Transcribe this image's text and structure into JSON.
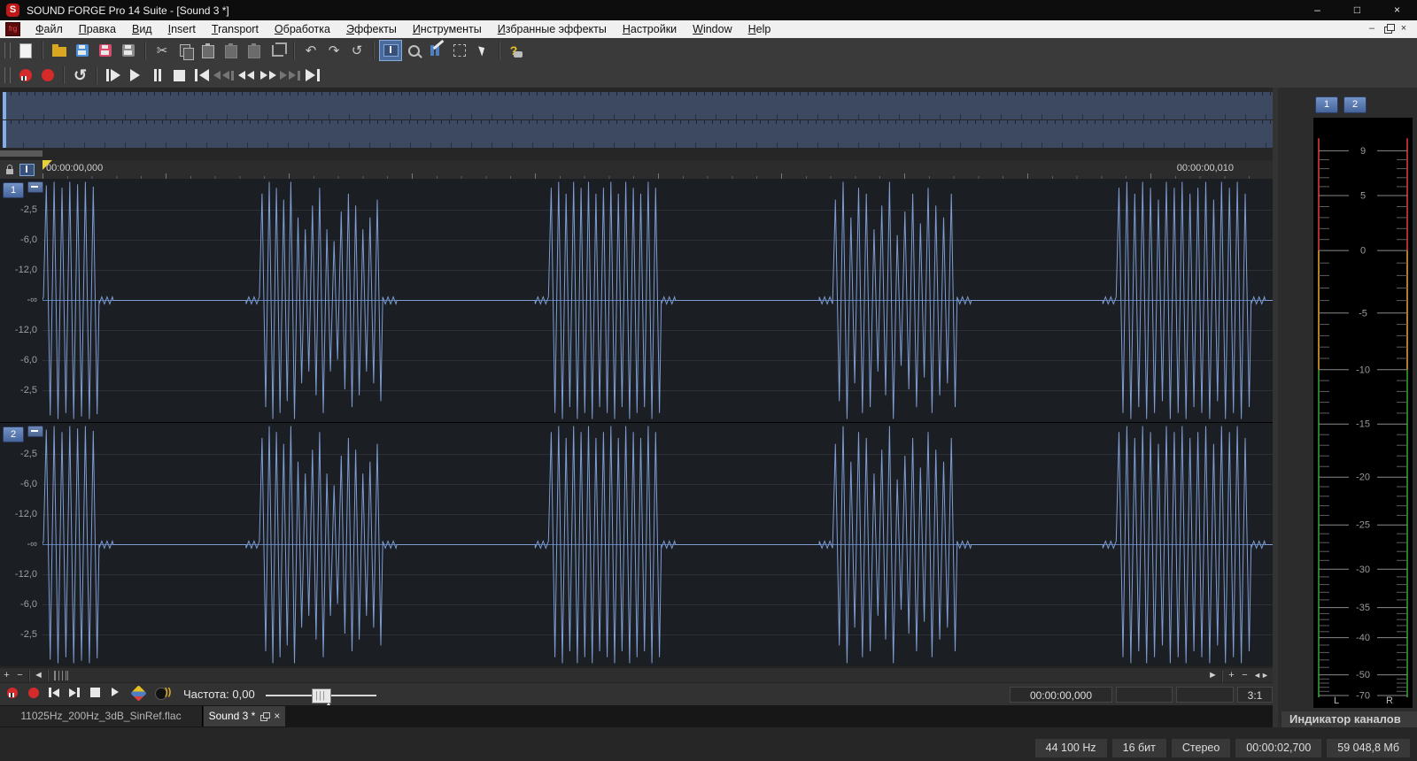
{
  "window": {
    "title": "SOUND FORGE Pro 14 Suite - [Sound 3 *]",
    "logo": "S"
  },
  "icons": {
    "minimize": "–",
    "maximize": "□",
    "close": "×",
    "plus": "+",
    "minus": "−",
    "left": "◄",
    "right": "►",
    "split": "◄►"
  },
  "menu": {
    "logo": "frg",
    "items": [
      "Файл",
      "Правка",
      "Вид",
      "Insert",
      "Transport",
      "Обработка",
      "Эффекты",
      "Инструменты",
      "Избранные эффекты",
      "Настройки",
      "Window",
      "Help"
    ]
  },
  "ruler": {
    "start_time": "00:00:00,000",
    "end_time": "00:00:00,010"
  },
  "channels": {
    "badges": [
      "1",
      "2"
    ]
  },
  "chart_data": {
    "type": "line",
    "title": "Stereo waveform, dB vertical scale, bursts of sine cycles separated by silence",
    "x_start": "00:00:00,000",
    "x_end": "00:00:00,010",
    "ylabels": [
      "-2,5",
      "-6,0",
      "-12,0",
      "-∞",
      "-12,0",
      "-6,0",
      "-2,5"
    ],
    "ylabel_offsets": [
      -102,
      -68,
      -34,
      0,
      34,
      68,
      102
    ],
    "bursts": [
      {
        "start": 0.0015,
        "end": 0.046,
        "amps": [
          0.97,
          1,
          0.95,
          1,
          0.98,
          1,
          0.96
        ]
      },
      {
        "start": 0.177,
        "end": 0.2765,
        "amps": [
          0.9,
          1,
          0.95,
          0.85,
          1,
          0.7,
          0.6,
          0.8,
          0.95,
          0.6,
          0.5,
          0.75,
          0.9,
          0.8,
          0.6,
          0.7,
          0.85
        ]
      },
      {
        "start": 0.412,
        "end": 0.503,
        "amps": [
          0.95,
          1,
          0.9,
          1,
          0.95,
          1,
          0.9,
          0.95,
          1,
          0.9,
          1,
          0.95,
          0.9,
          1,
          0.95
        ]
      },
      {
        "start": 0.643,
        "end": 0.7435,
        "amps": [
          0.85,
          1,
          0.7,
          0.95,
          0.9,
          0.6,
          0.8,
          1,
          0.55,
          0.75,
          0.9,
          0.65,
          0.95,
          0.8,
          0.7,
          0.9
        ]
      },
      {
        "start": 0.8735,
        "end": 0.9825,
        "amps": [
          0.95,
          1,
          0.9,
          1,
          0.95,
          0.85,
          1,
          0.95,
          1,
          0.9,
          0.95,
          1,
          0.85,
          1,
          0.95,
          1,
          0.9
        ]
      }
    ],
    "wave_color": "#7e9dd3",
    "center_line_color": "#5a7ab2"
  },
  "bottombar": {
    "freq_label": "Частота: 0,00",
    "time": "00:00:00,000",
    "ratio": "3:1"
  },
  "tabs": [
    {
      "label": "11025Hz_200Hz_3dB_SinRef.flac",
      "active": false
    },
    {
      "label": "Sound 3 *",
      "active": true
    }
  ],
  "meter": {
    "title": "Индикатор каналов",
    "buttons": [
      "1",
      "2"
    ],
    "channel_labels": [
      "L",
      "R"
    ],
    "scale": [
      {
        "label": "9",
        "frac": 0.056
      },
      {
        "label": "5",
        "frac": 0.132
      },
      {
        "label": "0",
        "frac": 0.225
      },
      {
        "label": "-5",
        "frac": 0.331
      },
      {
        "label": "-10",
        "frac": 0.427
      },
      {
        "label": "-15",
        "frac": 0.519
      },
      {
        "label": "-20",
        "frac": 0.609
      },
      {
        "label": "-25",
        "frac": 0.69
      },
      {
        "label": "-30",
        "frac": 0.765
      },
      {
        "label": "-35",
        "frac": 0.83
      },
      {
        "label": "-40",
        "frac": 0.881
      },
      {
        "label": "-50",
        "frac": 0.944
      },
      {
        "label": "-70",
        "frac": 0.979
      }
    ],
    "zones": [
      {
        "from": 0.035,
        "to": 0.225,
        "color": "#e03838"
      },
      {
        "from": 0.225,
        "to": 0.427,
        "color": "#e0a030"
      },
      {
        "from": 0.427,
        "to": 0.982,
        "color": "#2f9e2f"
      }
    ]
  },
  "statusbar": {
    "cells": [
      "44 100 Hz",
      "16 бит",
      "Стерео",
      "00:00:02,700",
      "59 048,8 Мб"
    ]
  }
}
